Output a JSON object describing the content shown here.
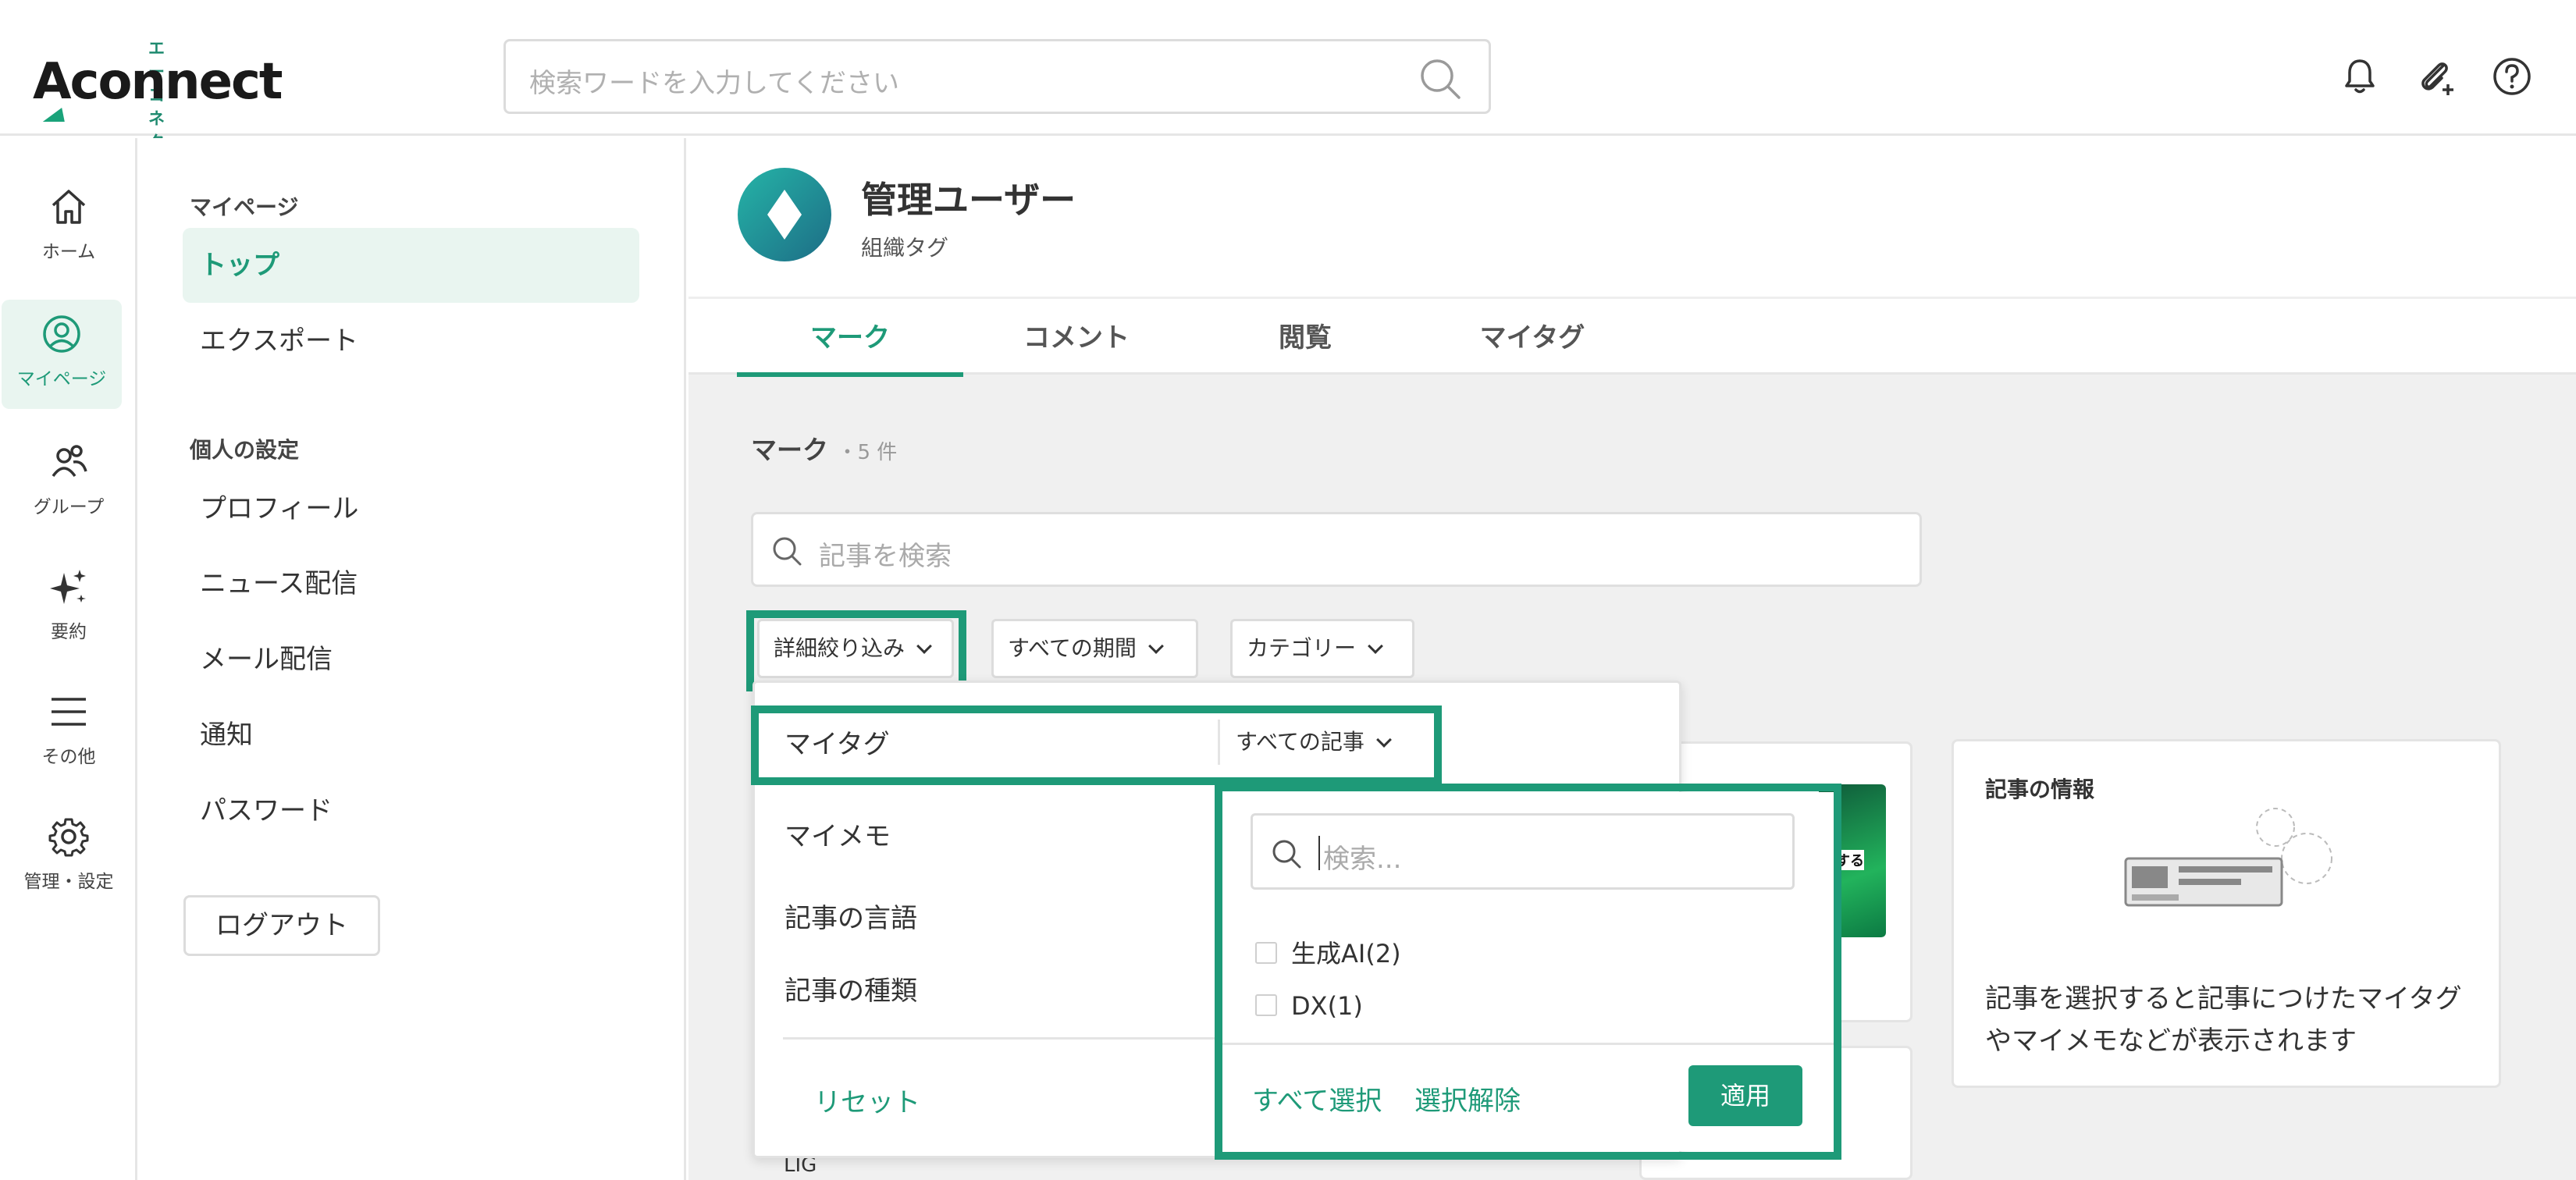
{
  "header": {
    "logo_kana": "エーコネクト",
    "logo_text": "Aconnect",
    "search_placeholder": "検索ワードを入力してください"
  },
  "rail": {
    "items": [
      {
        "label": "ホーム",
        "icon": "home-icon"
      },
      {
        "label": "マイページ",
        "icon": "user-circle-icon"
      },
      {
        "label": "グループ",
        "icon": "group-icon"
      },
      {
        "label": "要約",
        "icon": "sparkle-icon"
      },
      {
        "label": "その他",
        "icon": "menu-icon"
      },
      {
        "label": "管理・設定",
        "icon": "gear-icon"
      }
    ]
  },
  "subnav": {
    "section1": "マイページ",
    "items1": [
      "トップ",
      "エクスポート"
    ],
    "section2": "個人の設定",
    "items2": [
      "プロフィール",
      "ニュース配信",
      "メール配信",
      "通知",
      "パスワード"
    ],
    "logout": "ログアウト"
  },
  "profile": {
    "name": "管理ユーザー",
    "tag": "組織タグ"
  },
  "tabs": [
    "マーク",
    "コメント",
    "閲覧",
    "マイタグ"
  ],
  "content": {
    "title": "マーク",
    "count": "・5 件",
    "search_placeholder": "記事を検索",
    "filters": {
      "detail": "詳細絞り込み",
      "period": "すべての期間",
      "category": "カテゴリー"
    }
  },
  "dropdown": {
    "mytag_label": "マイタグ",
    "mytag_value": "すべての記事",
    "rows": [
      "マイメモ",
      "記事の言語",
      "記事の種類"
    ],
    "reset": "リセット"
  },
  "tag_dropdown": {
    "search_placeholder": "検索...",
    "options": [
      "生成AI(2)",
      "DX(1)"
    ],
    "select_all": "すべて選択",
    "deselect": "選択解除",
    "apply": "適用"
  },
  "info_card": {
    "title": "記事の情報",
    "message_line1": "記事を選択すると記事につけたマイタグ",
    "message_line2": "やマイメモなどが表示されます"
  },
  "background": {
    "partial_text_1": "化する",
    "partial_text_2": "LIG"
  },
  "colors": {
    "accent": "#1e9a78",
    "highlight": "#1e9a78"
  }
}
